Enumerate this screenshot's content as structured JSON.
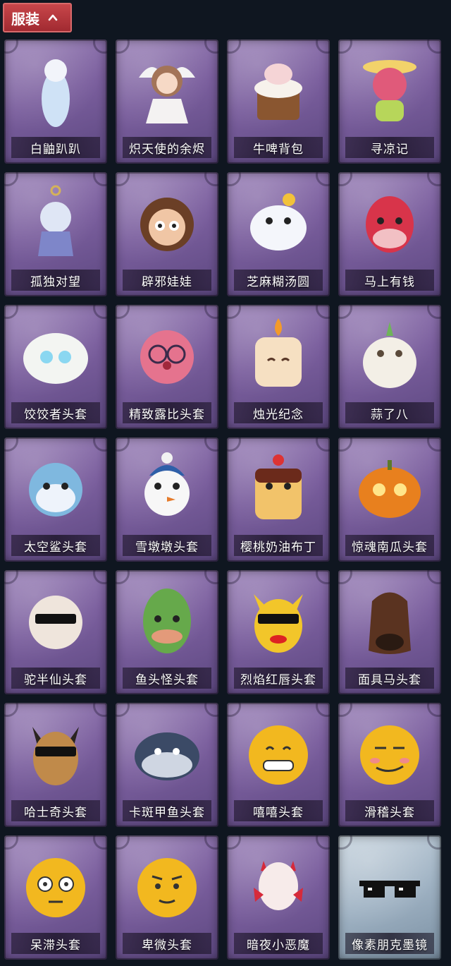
{
  "header": {
    "title": "服装",
    "icon": "chevron-up-icon",
    "accent": "#b5353b"
  },
  "items": [
    {
      "label": "白鼬趴趴",
      "icon": "ermine-plush-icon",
      "tone": "purple"
    },
    {
      "label": "炽天使的余烬",
      "icon": "angel-doll-icon",
      "tone": "purple"
    },
    {
      "label": "牛啤背包",
      "icon": "cow-beer-backpack-icon",
      "tone": "purple"
    },
    {
      "label": "寻凉记",
      "icon": "pink-bear-hat-icon",
      "tone": "purple"
    },
    {
      "label": "孤独对望",
      "icon": "keychain-charm-icon",
      "tone": "purple"
    },
    {
      "label": "辟邪娃娃",
      "icon": "girl-doll-head-icon",
      "tone": "purple"
    },
    {
      "label": "芝麻糊汤圆",
      "icon": "rice-ball-icon",
      "tone": "purple"
    },
    {
      "label": "马上有钱",
      "icon": "red-horse-icon",
      "tone": "purple"
    },
    {
      "label": "饺饺者头套",
      "icon": "dumpling-head-icon",
      "tone": "purple"
    },
    {
      "label": "精致露比头套",
      "icon": "pink-beaver-head-icon",
      "tone": "purple"
    },
    {
      "label": "烛光纪念",
      "icon": "candle-head-icon",
      "tone": "purple"
    },
    {
      "label": "蒜了八",
      "icon": "garlic-head-icon",
      "tone": "purple"
    },
    {
      "label": "太空鲨头套",
      "icon": "shark-head-icon",
      "tone": "purple"
    },
    {
      "label": "雪墩墩头套",
      "icon": "snowman-head-icon",
      "tone": "purple"
    },
    {
      "label": "樱桃奶油布丁",
      "icon": "pudding-head-icon",
      "tone": "purple"
    },
    {
      "label": "惊魂南瓜头套",
      "icon": "pumpkin-head-icon",
      "tone": "purple"
    },
    {
      "label": "驼半仙头套",
      "icon": "alpaca-sunglasses-head-icon",
      "tone": "purple"
    },
    {
      "label": "鱼头怪头套",
      "icon": "fish-head-icon",
      "tone": "purple"
    },
    {
      "label": "烈焰红唇头套",
      "icon": "yellow-mascot-head-icon",
      "tone": "purple"
    },
    {
      "label": "面具马头套",
      "icon": "horse-mask-icon",
      "tone": "purple"
    },
    {
      "label": "哈士奇头套",
      "icon": "husky-sunglasses-head-icon",
      "tone": "purple"
    },
    {
      "label": "卡斑甲鱼头套",
      "icon": "turtle-head-icon",
      "tone": "purple"
    },
    {
      "label": "嘻嘻头套",
      "icon": "grin-emoji-head-icon",
      "tone": "purple"
    },
    {
      "label": "滑稽头套",
      "icon": "funny-emoji-head-icon",
      "tone": "purple"
    },
    {
      "label": "呆滞头套",
      "icon": "stunned-emoji-head-icon",
      "tone": "purple"
    },
    {
      "label": "卑微头套",
      "icon": "humble-emoji-head-icon",
      "tone": "purple"
    },
    {
      "label": "暗夜小恶魔",
      "icon": "little-devil-head-icon",
      "tone": "purple"
    },
    {
      "label": "像素朋克墨镜",
      "icon": "pixel-sunglasses-icon",
      "tone": "silver"
    }
  ]
}
